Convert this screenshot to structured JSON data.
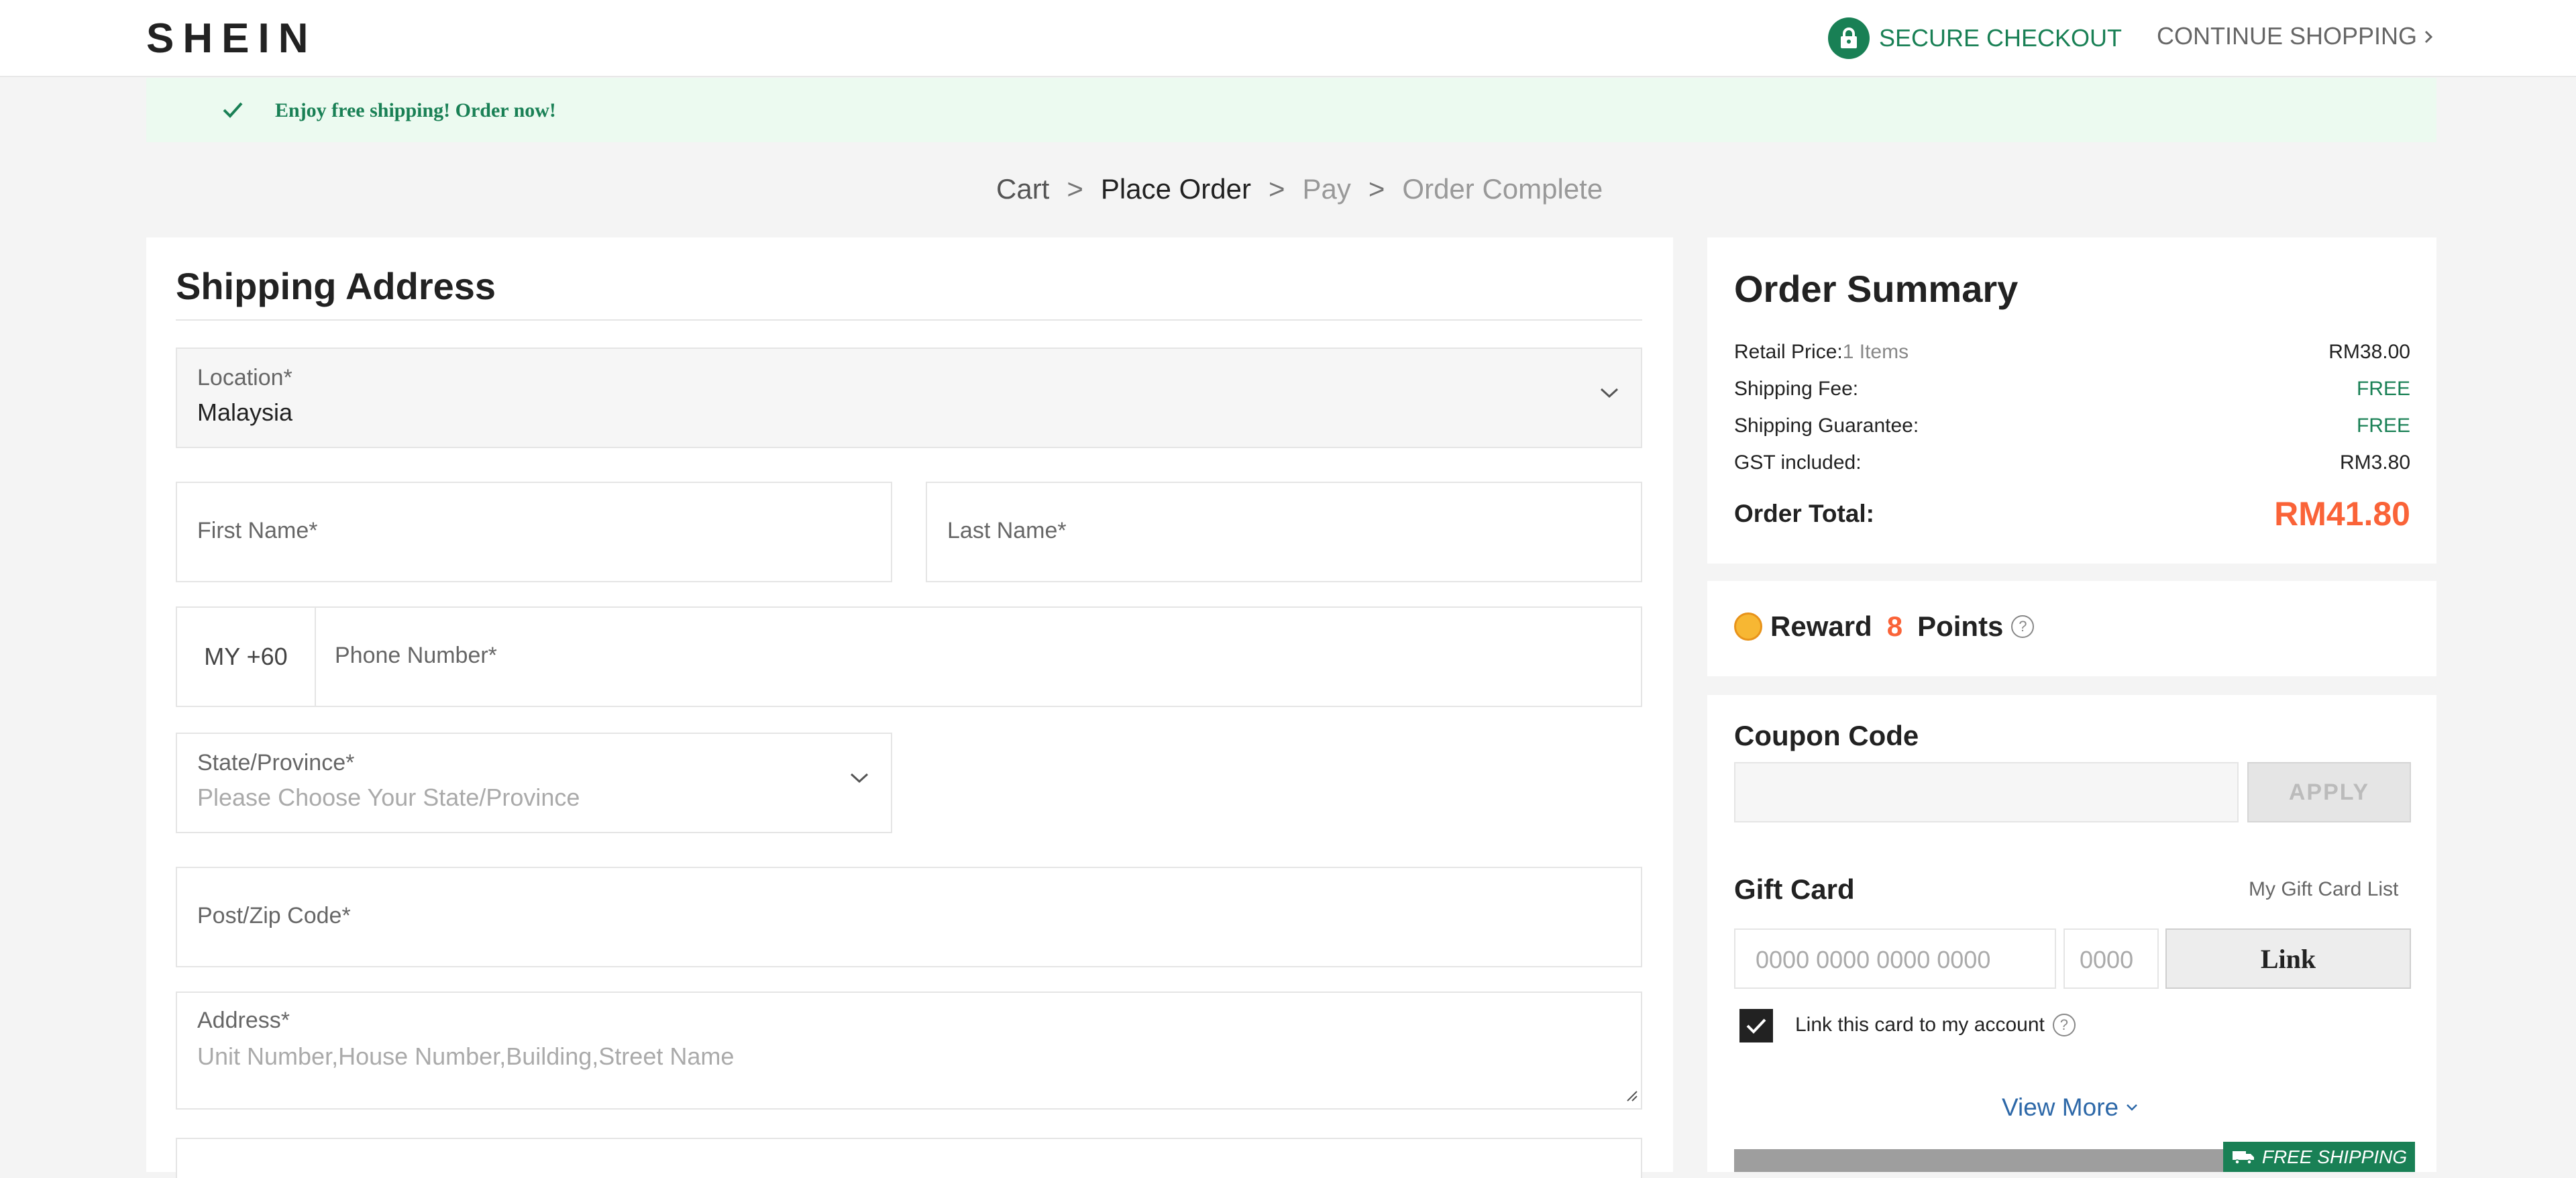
{
  "header": {
    "logo": "SHEIN",
    "secure_checkout": "SECURE CHECKOUT",
    "continue_shopping": "CONTINUE SHOPPING"
  },
  "banner": {
    "text": "Enjoy free shipping! Order now!"
  },
  "steps": [
    "Cart",
    "Place Order",
    "Pay",
    "Order Complete"
  ],
  "steps_separator": ">",
  "shipping": {
    "title": "Shipping Address",
    "location_label": "Location*",
    "location_value": "Malaysia",
    "first_name_label": "First Name*",
    "last_name_label": "Last Name*",
    "phone_prefix": "MY +60",
    "phone_label": "Phone Number*",
    "state_label": "State/Province*",
    "state_placeholder": "Please Choose Your State/Province",
    "postcode_label": "Post/Zip Code*",
    "address_label": "Address*",
    "address_placeholder": "Unit Number,House Number,Building,Street Name"
  },
  "summary": {
    "title": "Order Summary",
    "retail_label": "Retail Price:",
    "retail_items": "1 Items",
    "retail_value": "RM38.00",
    "shipping_fee_label": "Shipping Fee:",
    "shipping_fee_value": "FREE",
    "guarantee_label": "Shipping Guarantee:",
    "guarantee_value": "FREE",
    "gst_label": "GST included:",
    "gst_value": "RM3.80",
    "total_label": "Order Total:",
    "total_value": "RM41.80"
  },
  "reward": {
    "prefix": "Reward",
    "points": "8",
    "suffix": "Points"
  },
  "coupon": {
    "title": "Coupon Code",
    "apply": "APPLY"
  },
  "gift": {
    "title": "Gift Card",
    "list_link": "My Gift Card List",
    "number_placeholder": "0000 0000 0000 0000",
    "pin_placeholder": "0000",
    "link_button": "Link",
    "link_checkbox_label": "Link this card to my account",
    "link_checked": true
  },
  "view_more": "View More",
  "free_shipping_badge": "FREE SHIPPING",
  "colors": {
    "brand_green": "#198055",
    "accent_orange": "#fa6338",
    "link_blue": "#2d68a8"
  },
  "icons": [
    "lock-icon",
    "chevron-right-icon",
    "check-icon",
    "chevron-down-icon",
    "coin-icon",
    "question-icon",
    "truck-icon",
    "resize-handle-icon"
  ]
}
